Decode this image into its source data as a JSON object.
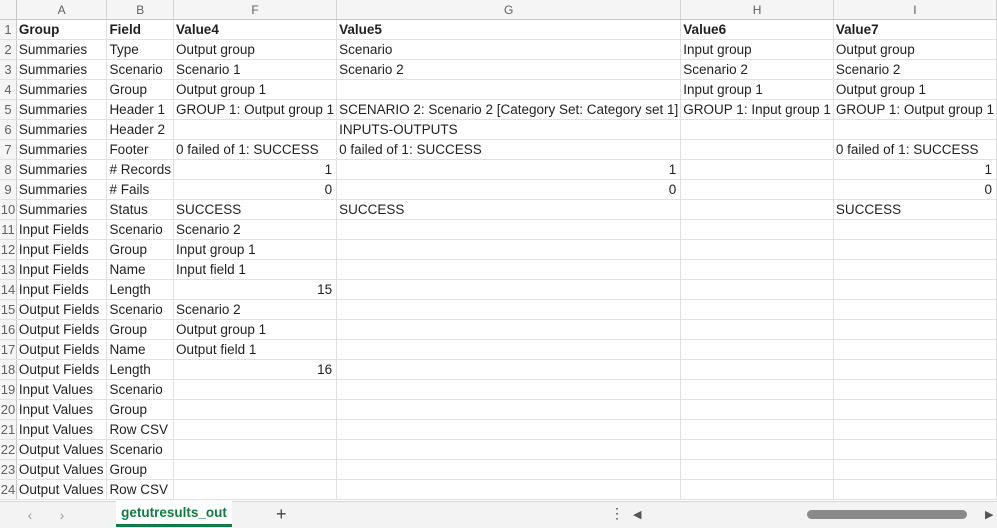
{
  "columns": [
    "A",
    "B",
    "F",
    "G",
    "H",
    "I"
  ],
  "rows": [
    [
      "Group",
      "Field",
      "Value4",
      "Value5",
      "Value6",
      "Value7"
    ],
    [
      "Summaries",
      "Type",
      "Output group",
      "Scenario",
      "Input group",
      "Output group"
    ],
    [
      "Summaries",
      "Scenario",
      "Scenario 1",
      "Scenario 2",
      "Scenario 2",
      "Scenario 2"
    ],
    [
      "Summaries",
      "Group",
      "Output group 1",
      "",
      "Input group 1",
      "Output group 1"
    ],
    [
      "Summaries",
      "Header 1",
      "GROUP 1: Output group 1",
      "SCENARIO 2: Scenario 2 [Category Set: Category set 1]",
      "GROUP 1: Input group 1",
      "GROUP 1: Output group 1"
    ],
    [
      "Summaries",
      "Header 2",
      "",
      "INPUTS-OUTPUTS",
      "",
      ""
    ],
    [
      "Summaries",
      "Footer",
      "0 failed of 1: SUCCESS",
      "0 failed of 1: SUCCESS",
      "",
      "0 failed of 1: SUCCESS"
    ],
    [
      "Summaries",
      "# Records",
      "1",
      "1",
      "",
      "1"
    ],
    [
      "Summaries",
      "# Fails",
      "0",
      "0",
      "",
      "0"
    ],
    [
      "Summaries",
      "Status",
      "SUCCESS",
      "SUCCESS",
      "",
      "SUCCESS"
    ],
    [
      "Input Fields",
      "Scenario",
      "Scenario 2",
      "",
      "",
      ""
    ],
    [
      "Input Fields",
      "Group",
      "Input group 1",
      "",
      "",
      ""
    ],
    [
      "Input Fields",
      "Name",
      "Input field 1",
      "",
      "",
      ""
    ],
    [
      "Input Fields",
      "Length",
      "15",
      "",
      "",
      ""
    ],
    [
      "Output Fields",
      "Scenario",
      "Scenario 2",
      "",
      "",
      ""
    ],
    [
      "Output Fields",
      "Group",
      "Output group 1",
      "",
      "",
      ""
    ],
    [
      "Output Fields",
      "Name",
      "Output field 1",
      "",
      "",
      ""
    ],
    [
      "Output Fields",
      "Length",
      "16",
      "",
      "",
      ""
    ],
    [
      "Input Values",
      "Scenario",
      "",
      "",
      "",
      ""
    ],
    [
      "Input Values",
      "Group",
      "",
      "",
      "",
      ""
    ],
    [
      "Input Values",
      "Row CSV",
      "",
      "",
      "",
      ""
    ],
    [
      "Output Values",
      "Scenario",
      "",
      "",
      "",
      ""
    ],
    [
      "Output Values",
      "Group",
      "",
      "",
      "",
      ""
    ],
    [
      "Output Values",
      "Row CSV",
      "",
      "",
      "",
      ""
    ]
  ],
  "sheet_tab": "getutresults_out",
  "add_sheet": "+",
  "icons": {
    "prev": "chevron-left-icon",
    "next": "chevron-right-icon",
    "more": "more-vertical-icon",
    "scroll_left": "scroll-left-icon",
    "scroll_right": "scroll-right-icon"
  },
  "colors": {
    "accent": "#107c41",
    "header_bg": "#f5f5f5",
    "gridline": "#e1e1e1"
  }
}
